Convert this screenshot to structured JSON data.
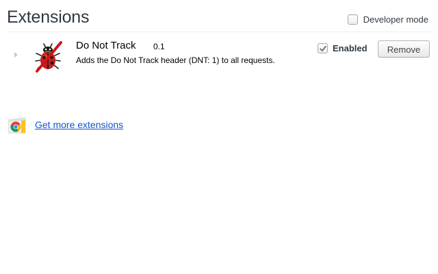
{
  "header": {
    "title": "Extensions",
    "developer_mode_label": "Developer mode",
    "developer_mode_checked": false
  },
  "extensions": [
    {
      "name": "Do Not Track",
      "version": "0.1",
      "description": "Adds the Do Not Track header (DNT: 1) to all requests.",
      "icon": "ladybug-crossed-icon",
      "enabled_label": "Enabled",
      "enabled": true,
      "remove_label": "Remove"
    }
  ],
  "footer": {
    "get_more_label": "Get more extensions",
    "icon": "web-store-icon"
  },
  "colors": {
    "link": "#1155cc",
    "text": "#303942",
    "rule": "#eeeeee"
  }
}
